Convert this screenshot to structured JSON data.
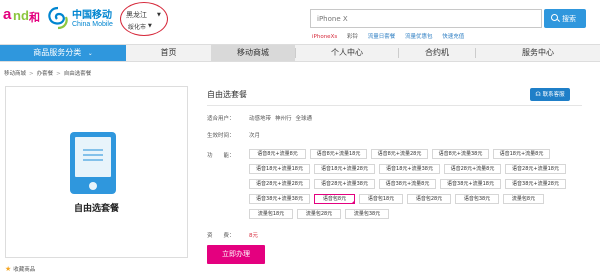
{
  "header": {
    "andhe_logo": {
      "a": "a",
      "nd": "nd",
      "he": "和"
    },
    "cm_logo_cn": "中国移动",
    "cm_logo_en": "China Mobile",
    "province": "黑龙江",
    "city": "绥化市",
    "search_placeholder": "iPhone X",
    "search_button": "搜索",
    "hot_words": [
      "iPhoneXs",
      "彩铃",
      "流量日套餐",
      "流量优惠包",
      "快速充值"
    ]
  },
  "nav": {
    "category": "商品服务分类",
    "items": [
      "首页",
      "移动商城",
      "个人中心",
      "合约机",
      "服务中心"
    ],
    "active_index": 1
  },
  "breadcrumb": [
    "移动商城",
    "办套餐",
    "自由选套餐"
  ],
  "product": {
    "image_caption": "自由选套餐",
    "title": "自由选套餐",
    "customer_service": "联系客服",
    "favorite": "收藏商品",
    "labels": {
      "users": "适合用户：",
      "effective": "生效时间：",
      "function": "功　　能：",
      "fee": "资　　费："
    },
    "users": [
      "动感地带",
      "神州行",
      "全球通"
    ],
    "effective": "次月",
    "options": [
      [
        "语音8元+流量8元",
        "语音8元+流量18元",
        "语音8元+流量28元",
        "语音8元+流量38元",
        "语音18元+流量8元"
      ],
      [
        "语音18元+流量18元",
        "语音18元+流量28元",
        "语音18元+流量38元",
        "语音28元+流量8元",
        "语音28元+流量18元"
      ],
      [
        "语音28元+流量28元",
        "语音28元+流量38元",
        "语音38元+流量8元",
        "语音38元+流量18元",
        "语音38元+流量28元"
      ],
      [
        "语音38元+流量38元",
        "语音包8元",
        "语音包18元",
        "语音包28元",
        "语音包38元",
        "流量包8元"
      ],
      [
        "流量包18元",
        "流量包28元",
        "流量包38元"
      ]
    ],
    "selected_option": "语音包8元",
    "price": "8元",
    "buy_button": "立即办理"
  },
  "colors": {
    "brand_blue": "#2f97dd",
    "brand_magenta": "#e4007f",
    "highlight_red": "#d6293b"
  }
}
